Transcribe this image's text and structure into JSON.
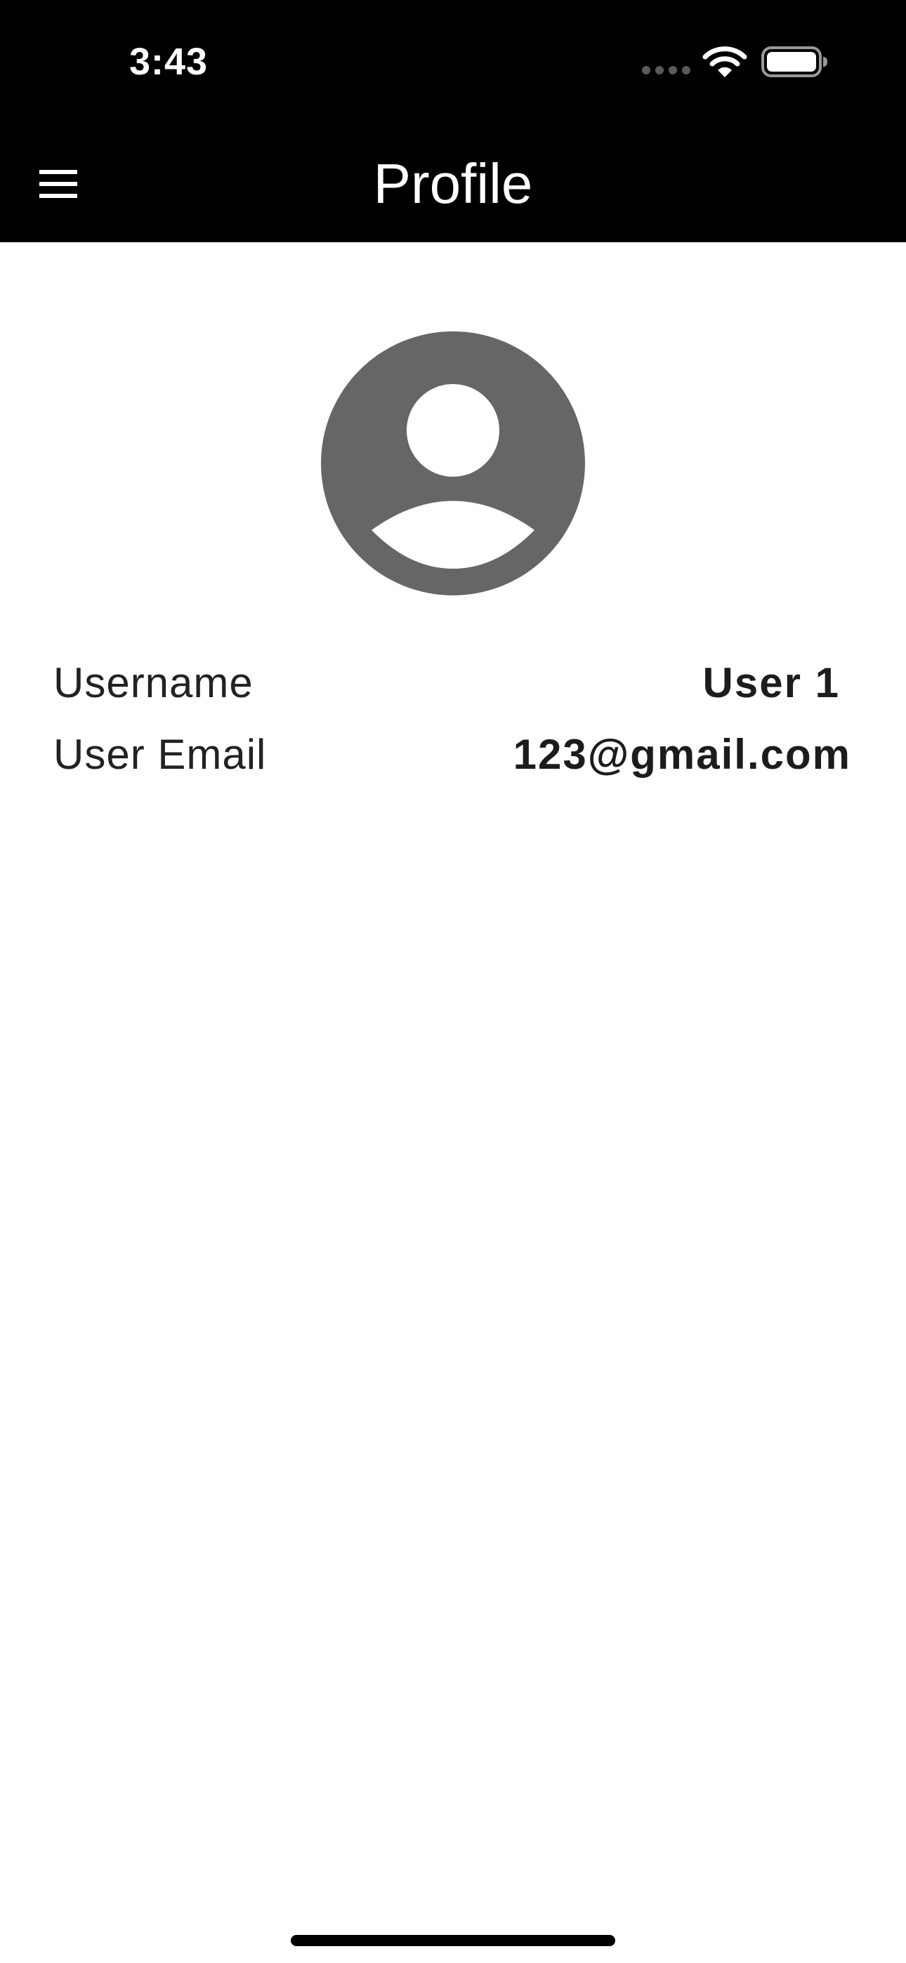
{
  "status_bar": {
    "time": "3:43",
    "icons": [
      "cellular-signal-icon",
      "wifi-icon",
      "battery-icon"
    ]
  },
  "app_bar": {
    "title": "Profile",
    "menu_icon": "hamburger-menu-icon",
    "background": "#000000",
    "foreground": "#ffffff"
  },
  "profile": {
    "avatar_icon": "account-circle-icon",
    "avatar_color": "#666666",
    "fields": [
      {
        "label": "Username",
        "value": "User 1"
      },
      {
        "label": "User Email",
        "value": "123@gmail.com"
      }
    ]
  }
}
